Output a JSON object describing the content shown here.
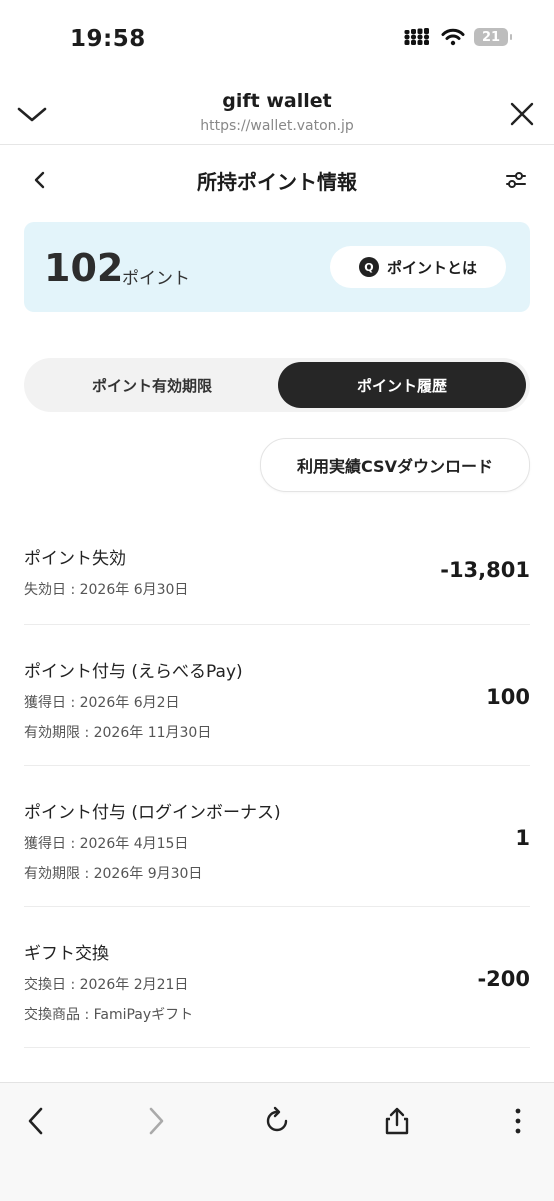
{
  "status_bar": {
    "time": "19:58",
    "battery": "21"
  },
  "browser": {
    "title": "gift wallet",
    "url": "https://wallet.vaton.jp"
  },
  "page": {
    "title": "所持ポイント情報"
  },
  "points": {
    "value": "102",
    "unit": "ポイント",
    "help_badge": "Q",
    "help_label": "ポイントとは"
  },
  "tabs": [
    {
      "label": "ポイント有効期限",
      "active": false
    },
    {
      "label": "ポイント履歴",
      "active": true
    }
  ],
  "csv_button": "利用実績CSVダウンロード",
  "history": [
    {
      "title": "ポイント失効",
      "lines": [
        "失効日 : 2026年 6月30日"
      ],
      "amount": "-13,801"
    },
    {
      "title": "ポイント付与 (えらべるPay)",
      "lines": [
        "獲得日 : 2026年 6月2日",
        "有効期限 : 2026年 11月30日"
      ],
      "amount": "100"
    },
    {
      "title": "ポイント付与 (ログインボーナス)",
      "lines": [
        "獲得日 : 2026年 4月15日",
        "有効期限 : 2026年 9月30日"
      ],
      "amount": "1"
    },
    {
      "title": "ギフト交換",
      "lines": [
        "交換日 : 2026年 2月21日",
        "交換商品 : FamiPayギフト"
      ],
      "amount": "-200"
    }
  ],
  "icons": {
    "back": "chevron-left-icon",
    "forward": "chevron-right-icon",
    "reload": "reload-icon",
    "share": "share-icon",
    "more": "more-vertical-icon",
    "collapse": "chevron-down-icon",
    "close": "close-icon",
    "settings": "sliders-icon"
  },
  "colors": {
    "card_bg": "#e3f4fa",
    "active_tab": "#262626"
  }
}
